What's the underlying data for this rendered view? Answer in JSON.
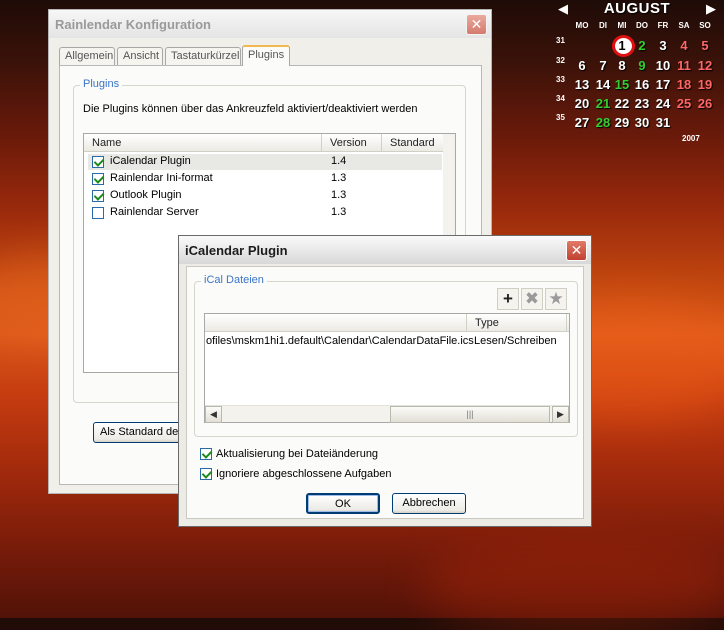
{
  "calendar": {
    "month": "AUGUST",
    "weekdays": [
      "MO",
      "DI",
      "MI",
      "DO",
      "FR",
      "SA",
      "SO"
    ],
    "weeks": [
      "31",
      "32",
      "33",
      "34",
      "35"
    ],
    "days": [
      [
        "",
        "",
        "1",
        "2",
        "3",
        "4",
        "5"
      ],
      [
        "6",
        "7",
        "8",
        "9",
        "10",
        "11",
        "12"
      ],
      [
        "13",
        "14",
        "15",
        "16",
        "17",
        "18",
        "19"
      ],
      [
        "20",
        "21",
        "22",
        "23",
        "24",
        "25",
        "26"
      ],
      [
        "27",
        "28",
        "29",
        "30",
        "31",
        "",
        ""
      ]
    ],
    "green_days": [
      "2",
      "9",
      "15",
      "21",
      "28"
    ],
    "red_days": [
      "4",
      "5",
      "11",
      "12",
      "18",
      "19",
      "25",
      "26"
    ],
    "today": "1",
    "year": "2007",
    "colors": {
      "green": "#33cc33",
      "red": "#ff6666",
      "today_ring": "#e01010"
    }
  },
  "main_window": {
    "title": "Rainlendar Konfiguration",
    "close_label": "✕",
    "tabs": [
      "Allgemein",
      "Ansicht",
      "Tastaturkürzel",
      "Plugins"
    ],
    "active_tab": "Plugins",
    "plugins_group": {
      "label": "Plugins",
      "description": "Die Plugins können über das Ankreuzfeld aktiviert/deaktiviert werden",
      "columns": [
        "Name",
        "Version",
        "Standard"
      ],
      "rows": [
        {
          "name": "iCalendar Plugin",
          "version": "1.4",
          "checked": true,
          "selected": true
        },
        {
          "name": "Rainlendar Ini-format",
          "version": "1.3",
          "checked": true,
          "selected": false
        },
        {
          "name": "Outlook Plugin",
          "version": "1.3",
          "checked": true,
          "selected": false
        },
        {
          "name": "Rainlendar Server",
          "version": "1.3",
          "checked": false,
          "selected": false
        }
      ],
      "default_button": "Als Standard defini"
    }
  },
  "dialog": {
    "title": "iCalendar Plugin",
    "close_label": "✕",
    "group_label": "iCal Dateien",
    "toolbar": {
      "add": "+",
      "remove": "✖",
      "favorite": "★"
    },
    "columns": [
      "",
      "Type"
    ],
    "rows": [
      {
        "path": "ofiles\\mskm1hi1.default\\Calendar\\CalendarDataFile.ics",
        "type": "Lesen/Schreiben"
      }
    ],
    "scroll": {
      "left": "◀",
      "right": "▶",
      "grip": "|||"
    },
    "options": [
      {
        "label": "Aktualisierung bei Dateiänderung",
        "checked": true
      },
      {
        "label": "Ignoriere abgeschlossene Aufgaben",
        "checked": true
      }
    ],
    "ok_label": "OK",
    "cancel_label": "Abbrechen"
  }
}
